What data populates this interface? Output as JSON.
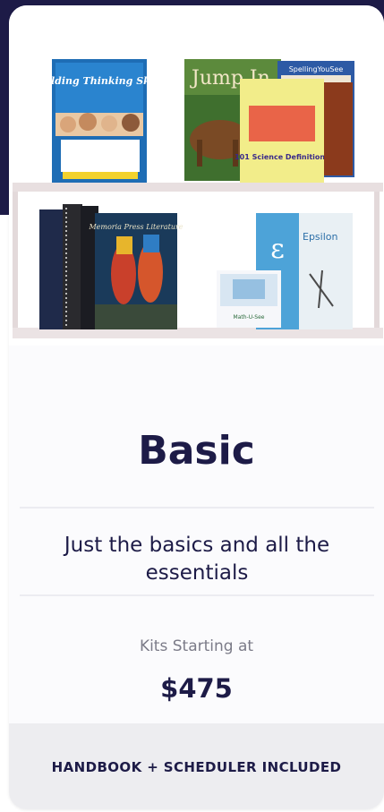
{
  "plan": {
    "title": "Basic",
    "description": "Just the basics and all the essentials",
    "price_label": "Kits Starting at",
    "price": "$475",
    "footer_note": "HANDBOOK + SCHEDULER INCLUDED"
  },
  "image": {
    "book_titles": [
      "Building Thinking Skills",
      "Jump In",
      "SpellingYouSee",
      "101 Science Definitions",
      "Memoria Press Literature",
      "Epsilon",
      "Math-U-See"
    ]
  },
  "colors": {
    "navy": "#1d1b47",
    "card_background": "#fbfbfd",
    "footer_background": "#ededf0",
    "muted_text": "#7b7b88",
    "divider": "#ececf1"
  }
}
